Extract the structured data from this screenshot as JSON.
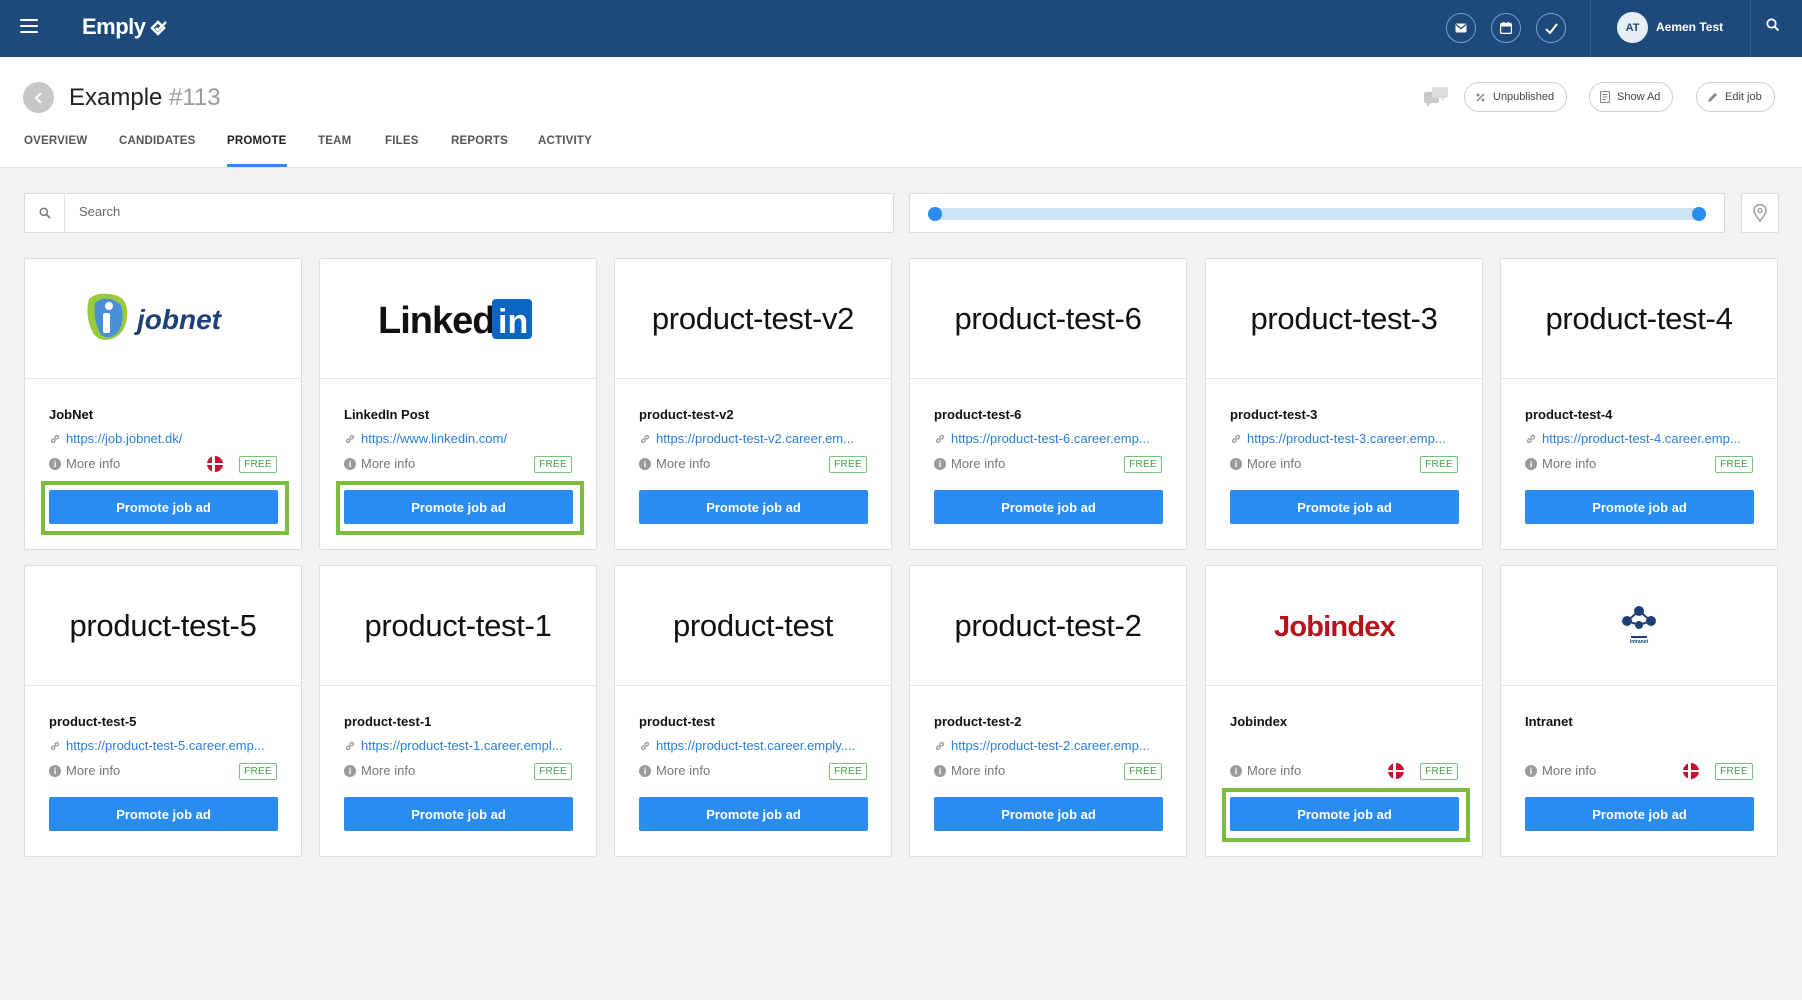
{
  "topbar": {
    "brand": "Emply",
    "avatar_initials": "AT",
    "username": "Aemen Test",
    "icons": [
      "mail-icon",
      "calendar-icon",
      "check-icon",
      "search-icon"
    ]
  },
  "header": {
    "title": "Example",
    "job_number": "#113",
    "status_label": "Unpublished",
    "show_ad_label": "Show Ad",
    "edit_job_label": "Edit job",
    "tabs": [
      {
        "label": "OVERVIEW",
        "active": false
      },
      {
        "label": "CANDIDATES",
        "active": false
      },
      {
        "label": "PROMOTE",
        "active": true
      },
      {
        "label": "TEAM",
        "active": false
      },
      {
        "label": "FILES",
        "active": false
      },
      {
        "label": "REPORTS",
        "active": false
      },
      {
        "label": "ACTIVITY",
        "active": false
      }
    ]
  },
  "search": {
    "placeholder": "Search",
    "value": ""
  },
  "range_slider": {
    "min_fraction": 0.0,
    "max_fraction": 1.0
  },
  "colors": {
    "topbar": "#1e4a7b",
    "primary": "#2a8cf0",
    "highlight": "#7cbe3c",
    "free": "#3fa245"
  },
  "cards": [
    {
      "logo_text": "",
      "logo_type": "jobnet",
      "name": "JobNet",
      "url": "https://job.jobnet.dk/",
      "more_info": "More info",
      "flag": "dk",
      "badge": "FREE",
      "button": "Promote job ad",
      "highlighted": true
    },
    {
      "logo_text": "",
      "logo_type": "linkedin",
      "name": "LinkedIn Post",
      "url": "https://www.linkedin.com/",
      "more_info": "More info",
      "flag": "",
      "badge": "FREE",
      "button": "Promote job ad",
      "highlighted": true
    },
    {
      "logo_text": "product-test-v2",
      "logo_type": "text",
      "name": "product-test-v2",
      "url": "https://product-test-v2.career.em...",
      "more_info": "More info",
      "flag": "",
      "badge": "FREE",
      "button": "Promote job ad",
      "highlighted": false
    },
    {
      "logo_text": "product-test-6",
      "logo_type": "text",
      "name": "product-test-6",
      "url": "https://product-test-6.career.emp...",
      "more_info": "More info",
      "flag": "",
      "badge": "FREE",
      "button": "Promote job ad",
      "highlighted": false
    },
    {
      "logo_text": "product-test-3",
      "logo_type": "text",
      "name": "product-test-3",
      "url": "https://product-test-3.career.emp...",
      "more_info": "More info",
      "flag": "",
      "badge": "FREE",
      "button": "Promote job ad",
      "highlighted": false
    },
    {
      "logo_text": "product-test-4",
      "logo_type": "text",
      "name": "product-test-4",
      "url": "https://product-test-4.career.emp...",
      "more_info": "More info",
      "flag": "",
      "badge": "FREE",
      "button": "Promote job ad",
      "highlighted": false
    },
    {
      "logo_text": "product-test-5",
      "logo_type": "text",
      "name": "product-test-5",
      "url": "https://product-test-5.career.emp...",
      "more_info": "More info",
      "flag": "",
      "badge": "FREE",
      "button": "Promote job ad",
      "highlighted": false
    },
    {
      "logo_text": "product-test-1",
      "logo_type": "text",
      "name": "product-test-1",
      "url": "https://product-test-1.career.empl...",
      "more_info": "More info",
      "flag": "",
      "badge": "FREE",
      "button": "Promote job ad",
      "highlighted": false
    },
    {
      "logo_text": "product-test",
      "logo_type": "text",
      "name": "product-test",
      "url": "https://product-test.career.emply....",
      "more_info": "More info",
      "flag": "",
      "badge": "FREE",
      "button": "Promote job ad",
      "highlighted": false
    },
    {
      "logo_text": "product-test-2",
      "logo_type": "text",
      "name": "product-test-2",
      "url": "https://product-test-2.career.emp...",
      "more_info": "More info",
      "flag": "",
      "badge": "FREE",
      "button": "Promote job ad",
      "highlighted": false
    },
    {
      "logo_text": "Jobindex",
      "logo_type": "jobindex",
      "name": "Jobindex",
      "url": "",
      "more_info": "More info",
      "flag": "dk",
      "badge": "FREE",
      "button": "Promote job ad",
      "highlighted": true
    },
    {
      "logo_text": "Intranet",
      "logo_type": "intranet",
      "name": "Intranet",
      "url": "",
      "more_info": "More info",
      "flag": "dk",
      "badge": "FREE",
      "button": "Promote job ad",
      "highlighted": false
    }
  ]
}
